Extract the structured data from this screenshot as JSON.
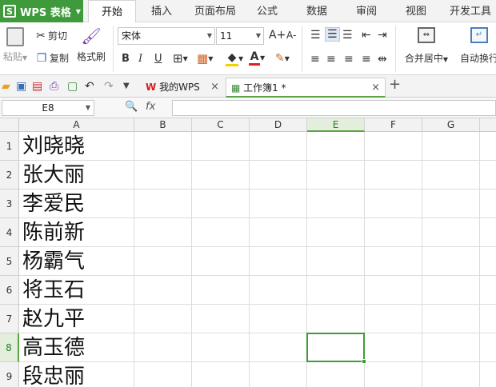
{
  "app": {
    "name": "WPS 表格",
    "logo_letter": "S",
    "accent": "#3e9a3b"
  },
  "menu": [
    "开始",
    "插入",
    "页面布局",
    "公式",
    "数据",
    "审阅",
    "视图",
    "开发工具"
  ],
  "ribbon": {
    "paste": "粘贴",
    "cut": "剪切",
    "copy": "复制",
    "format_painter": "格式刷",
    "font_name": "宋体",
    "font_size": "11",
    "grow_font": "A+",
    "shrink_font": "A-",
    "bold": "B",
    "italic": "I",
    "underline": "U",
    "merge_center": "合并居中",
    "wrap_text": "自动换行"
  },
  "doc_tabs": [
    {
      "label": "我的WPS",
      "active": false
    },
    {
      "label": "工作簿1 *",
      "active": true
    }
  ],
  "formula_bar": {
    "name_box": "E8",
    "fx": "fx",
    "value": ""
  },
  "grid": {
    "columns": [
      "A",
      "B",
      "C",
      "D",
      "E",
      "F",
      "G"
    ],
    "selected_column": "E",
    "rows": [
      {
        "num": "1",
        "a": "刘晓晓"
      },
      {
        "num": "2",
        "a": "张大丽"
      },
      {
        "num": "3",
        "a": "李爱民"
      },
      {
        "num": "4",
        "a": "陈前新"
      },
      {
        "num": "5",
        "a": "杨霸气"
      },
      {
        "num": "6",
        "a": "将玉石"
      },
      {
        "num": "7",
        "a": "赵九平"
      },
      {
        "num": "8",
        "a": "高玉德"
      },
      {
        "num": "9",
        "a": "段忠丽"
      }
    ],
    "selected_row": "8",
    "selected_cell": "E8"
  }
}
